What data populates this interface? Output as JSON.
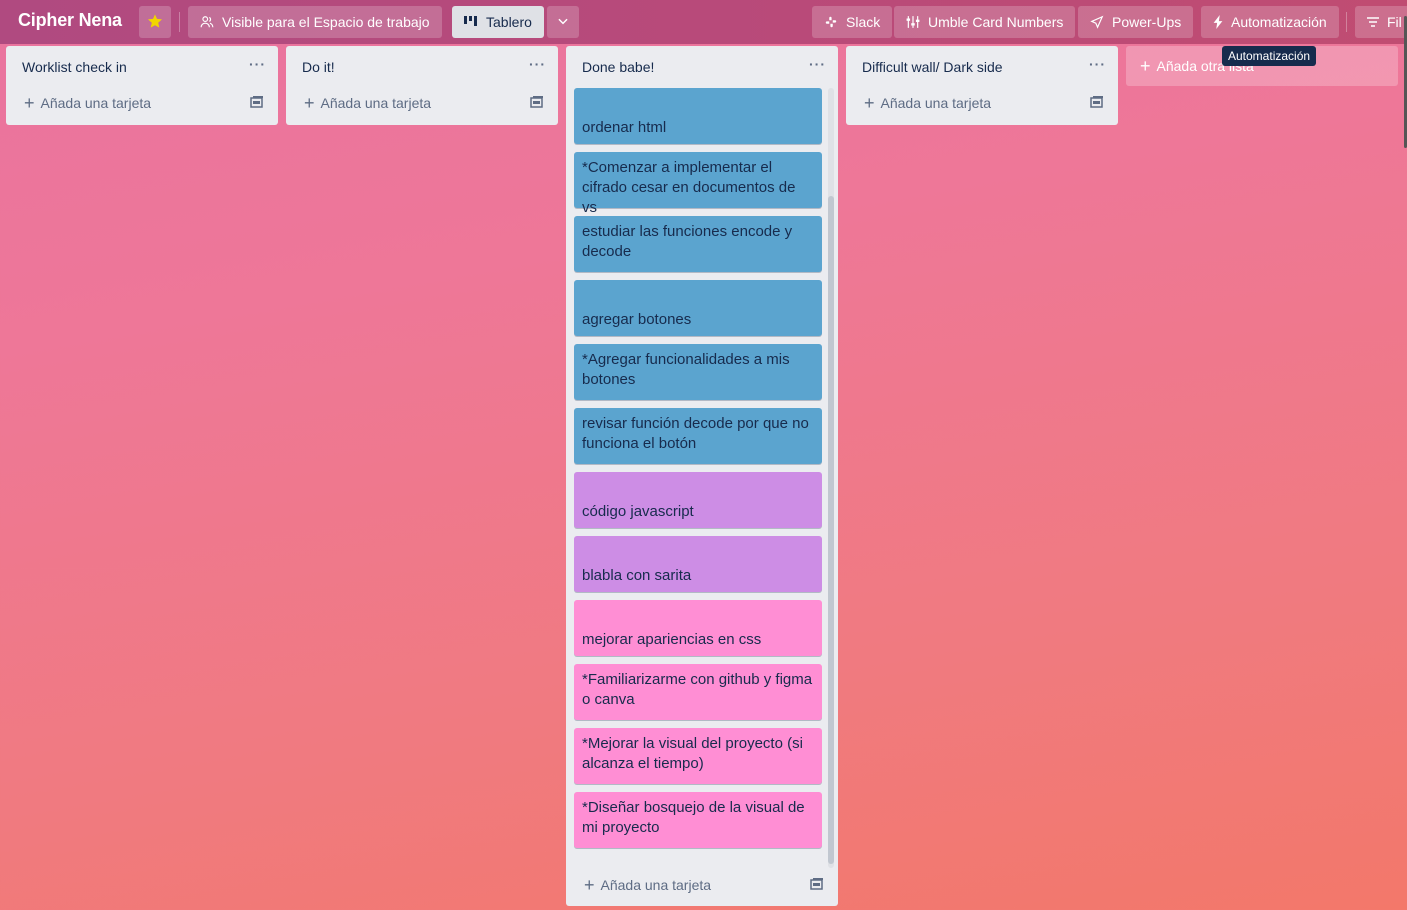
{
  "board": {
    "title": "Cipher Nena",
    "visibility_label": "Visible para el Espacio de trabajo",
    "view_label": "Tablero",
    "buttons": {
      "slack": "Slack",
      "umble": "Umble Card Numbers",
      "powerups": "Power-Ups",
      "automation": "Automatización",
      "filter": "Fil"
    },
    "tooltip": "Automatización",
    "colors": {
      "star": "#f2d600",
      "header": "#b64a7c"
    }
  },
  "lists": [
    {
      "title": "Worklist check in",
      "add_label": "Añada una tarjeta",
      "cards": []
    },
    {
      "title": "Do it!",
      "add_label": "Añada una tarjeta",
      "cards": []
    },
    {
      "title": "Done babe!",
      "add_label": "Añada una tarjeta",
      "cards": [
        {
          "text": "ordenar html",
          "color": "#5ba4cf"
        },
        {
          "text": "*Comenzar a implementar el cifrado cesar en documentos de vs",
          "color": "#5ba4cf"
        },
        {
          "text": "estudiar las funciones encode y decode",
          "color": "#5ba4cf"
        },
        {
          "text": "agregar botones",
          "color": "#5ba4cf"
        },
        {
          "text": "*Agregar funcionalidades a mis botones",
          "color": "#5ba4cf"
        },
        {
          "text": "revisar función decode por que no funciona el botón",
          "color": "#5ba4cf"
        },
        {
          "text": "código javascript",
          "color": "#cd8de5"
        },
        {
          "text": "blabla con sarita",
          "color": "#cd8de5"
        },
        {
          "text": "mejorar apariencias en css",
          "color": "#ff8ed4"
        },
        {
          "text": "*Familiarizarme con github y figma o canva",
          "color": "#ff8ed4"
        },
        {
          "text": "*Mejorar la visual del proyecto (si alcanza el tiempo)",
          "color": "#ff8ed4"
        },
        {
          "text": "*Diseñar bosquejo de la visual de mi proyecto",
          "color": "#ff8ed4"
        }
      ]
    },
    {
      "title": "Difficult wall/ Dark side",
      "add_label": "Añada una tarjeta",
      "cards": []
    }
  ],
  "add_list_label": "Añada otra lista"
}
